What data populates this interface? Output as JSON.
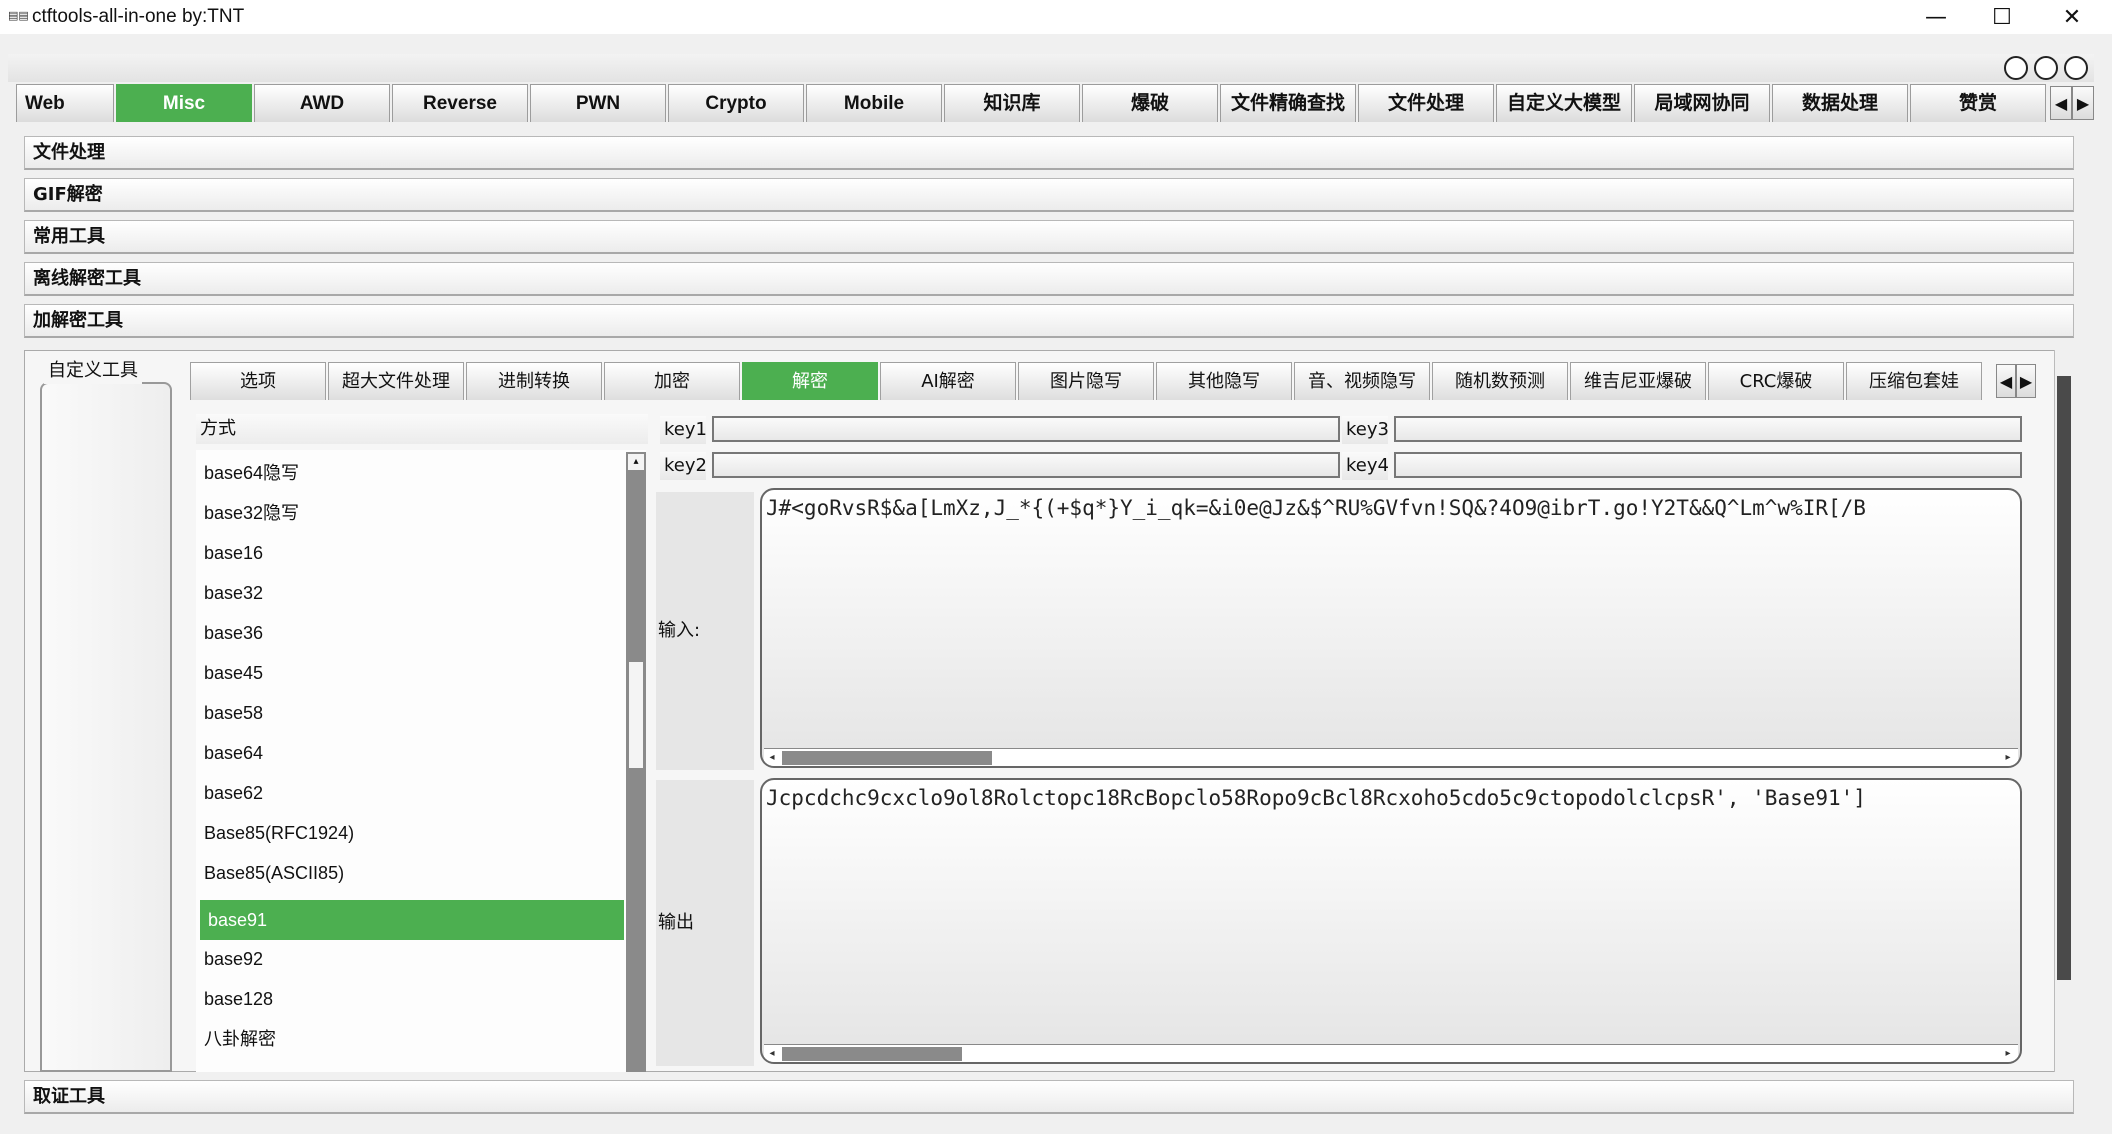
{
  "window": {
    "title": "ctftools-all-in-one   by:TNT",
    "icon_name": "app-icon",
    "minimize": "—",
    "maximize": "☐",
    "close": "✕"
  },
  "main_tabs": [
    "Web",
    "Misc",
    "AWD",
    "Reverse",
    "PWN",
    "Crypto",
    "Mobile",
    "知识库",
    "爆破",
    "文件精确查找",
    "文件处理",
    "自定义大模型",
    "局域网协同",
    "数据处理",
    "赞赏"
  ],
  "main_tab_active": "Misc",
  "sections_top": [
    "文件处理",
    "GIF解密",
    "常用工具",
    "离线解密工具",
    "加解密工具"
  ],
  "section_bottom": "取证工具",
  "side_group_label": "自定义工具",
  "sub_tabs": [
    "选项",
    "超大文件处理",
    "进制转换",
    "加密",
    "解密",
    "AI解密",
    "图片隐写",
    "其他隐写",
    "音、视频隐写",
    "随机数预测",
    "维吉尼亚爆破",
    "CRC爆破",
    "压缩包套娃"
  ],
  "sub_tab_active": "解密",
  "method_header": "方式",
  "methods": [
    "base64隐写",
    "base32隐写",
    "base16",
    "base32",
    "base36",
    "base45",
    "base58",
    "base64",
    "base62",
    "Base85(RFC1924)",
    "Base85(ASCII85)",
    "base91",
    "base92",
    "base128",
    "八卦解密"
  ],
  "method_selected": "base91",
  "keys": {
    "key1_label": "key1",
    "key1_value": "",
    "key2_label": "key2",
    "key2_value": "",
    "key3_label": "key3",
    "key3_value": "",
    "key4_label": "key4",
    "key4_value": ""
  },
  "input": {
    "label": "输入:",
    "text": "J#<goRvsR$&a[LmXz,J_*{(+$q*}Y_i_qk=&i0e@Jz&$^RU%GVfvn!SQ&?4O9@ibrT.go!Y2T&&Q^Lm^w%IR[/B"
  },
  "output": {
    "label": "输出",
    "text": "Jcpcdchc9cxclo9ol8Rolctopc18RcBopclo58Ropo9cBcl8Rcxoho5cdo5c9ctopodolclcpsR', 'Base91']"
  },
  "colors": {
    "accent": "#4caf50",
    "tab_bg": "#e6e6e6",
    "scroll": "#8a8a8a"
  }
}
